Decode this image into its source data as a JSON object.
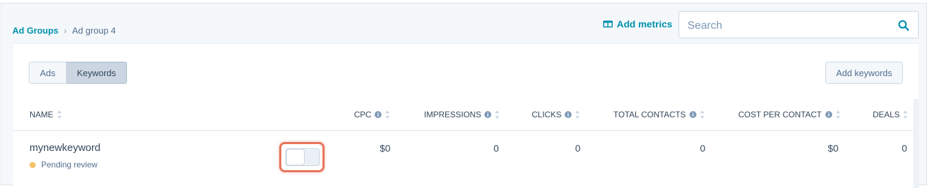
{
  "breadcrumb": {
    "parent": "Ad Groups",
    "separator": "›",
    "current": "Ad group 4"
  },
  "toolbar": {
    "add_metrics_label": "Add metrics",
    "add_metrics_icon": "columns-icon",
    "search_placeholder": "Search",
    "search_value": "",
    "search_icon": "search-icon"
  },
  "tabs": [
    {
      "label": "Ads",
      "active": false
    },
    {
      "label": "Keywords",
      "active": true
    }
  ],
  "add_keywords_label": "Add keywords",
  "table": {
    "columns": [
      {
        "label": "NAME",
        "info": false
      },
      {
        "label": "CPC",
        "info": true
      },
      {
        "label": "IMPRESSIONS",
        "info": true
      },
      {
        "label": "CLICKS",
        "info": true
      },
      {
        "label": "TOTAL CONTACTS",
        "info": true
      },
      {
        "label": "COST PER CONTACT",
        "info": true
      },
      {
        "label": "DEALS",
        "info": false
      }
    ],
    "rows": [
      {
        "name": "mynewkeyword",
        "status": "Pending review",
        "status_color": "#f5c26b",
        "toggle_on": false,
        "cpc": "$0",
        "impressions": "0",
        "clicks": "0",
        "total_contacts": "0",
        "cost_per_contact": "$0",
        "deals": "0"
      }
    ]
  },
  "colors": {
    "link": "#0091ae",
    "highlight": "#e8725a",
    "text": "#33475b"
  }
}
